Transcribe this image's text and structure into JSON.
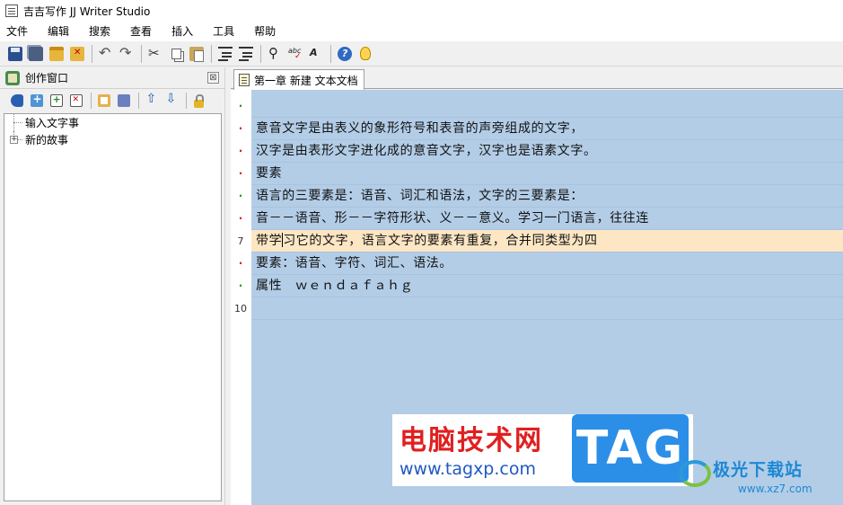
{
  "window": {
    "title": "吉吉写作 JJ Writer Studio"
  },
  "menubar": {
    "items": [
      "文件",
      "编辑",
      "搜索",
      "查看",
      "插入",
      "工具",
      "帮助"
    ]
  },
  "toolbar": {
    "buttons": [
      "save-icon",
      "save-all-icon",
      "open-icon",
      "close-file-icon",
      "undo-icon",
      "redo-icon",
      "cut-icon",
      "copy-icon",
      "paste-icon",
      "outdent-icon",
      "indent-icon",
      "find-icon",
      "spellcheck-icon",
      "replace-icon",
      "help-icon",
      "tip-icon"
    ]
  },
  "left_panel": {
    "title": "创作窗口",
    "close_glyph": "⊠",
    "toolbar_icons": [
      "book-icon",
      "add-group-icon",
      "add-document-icon",
      "delete-icon",
      "properties-icon",
      "notes-icon",
      "move-up-icon",
      "move-down-icon",
      "lock-icon"
    ],
    "tree": [
      {
        "label": "输入文字事",
        "expandable": false
      },
      {
        "label": "新的故事",
        "expandable": true,
        "expander": "+"
      }
    ]
  },
  "editor": {
    "tab_label": "第一章 新建 文本文档",
    "current_line": 7,
    "lines": [
      {
        "gutter": "·",
        "mark": "green",
        "text": ""
      },
      {
        "gutter": "·",
        "mark": "red",
        "text": "意音文字是由表义的象形符号和表音的声旁组成的文字，"
      },
      {
        "gutter": "·",
        "mark": "red",
        "text": "汉字是由表形文字进化成的意音文字，汉字也是语素文字。"
      },
      {
        "gutter": "·",
        "mark": "red",
        "text": "要素"
      },
      {
        "gutter": "·",
        "mark": "green",
        "text": "语言的三要素是：语音、词汇和语法，文字的三要素是："
      },
      {
        "gutter": "·",
        "mark": "red",
        "text": "音－－语音、形－－字符形状、义－－意义。学习一门语言，往往连"
      },
      {
        "gutter": "7",
        "mark": "none",
        "text_before_caret": "带学",
        "text_after_caret": "习它的文字，语言文字的要素有重复，合并同类型为四"
      },
      {
        "gutter": "·",
        "mark": "red",
        "text": "要素：语音、字符、词汇、语法。"
      },
      {
        "gutter": "·",
        "mark": "green",
        "text": "属性　ｗｅｎｄａｆａｈｇ"
      },
      {
        "gutter": "10",
        "mark": "none",
        "text": ""
      }
    ]
  },
  "watermark": {
    "site_name": "电脑技术网",
    "site_url": "www.tagxp.com",
    "tag_text": "TAG",
    "brand2_name": "极光下载站",
    "brand2_url": "www.xz7.com"
  },
  "colors": {
    "editor_bg": "#b3cde7",
    "current_line_bg": "#fde6c4",
    "gutter_mark_red": "#d22222",
    "gutter_mark_green": "#2a9a2a",
    "tag_blue": "#2b8fe8",
    "watermark_red": "#e02020"
  }
}
